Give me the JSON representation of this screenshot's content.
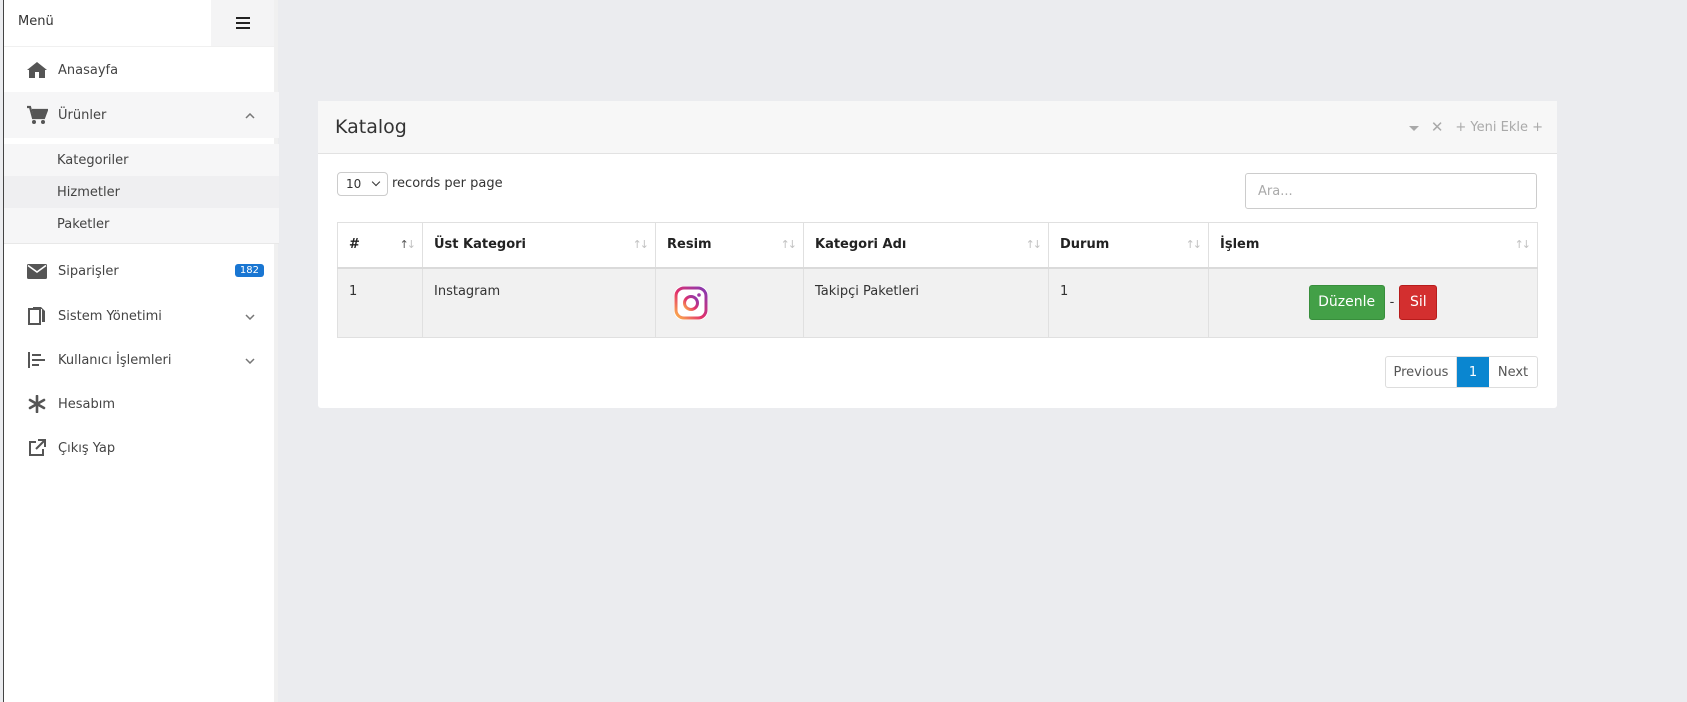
{
  "sidebar": {
    "menu_label": "Menü",
    "items": {
      "home": "Anasayfa",
      "products": "Ürünler",
      "categories": "Kategoriler",
      "services": "Hizmetler",
      "packages": "Paketler",
      "orders": "Siparişler",
      "orders_badge": "182",
      "system": "Sistem Yönetimi",
      "users": "Kullanıcı İşlemleri",
      "account": "Hesabım",
      "logout": "Çıkış Yap"
    }
  },
  "card": {
    "title": "Katalog",
    "add_new": "+ Yeni Ekle +"
  },
  "table_controls": {
    "length_value": "10",
    "length_text": "records per page",
    "search_placeholder": "Ara..."
  },
  "table": {
    "columns": [
      "#",
      "Üst Kategori",
      "Resim",
      "Kategori Adı",
      "Durum",
      "İşlem"
    ],
    "rows": [
      {
        "id": "1",
        "parent": "Instagram",
        "image_icon": "instagram-icon",
        "name": "Takipçi Paketleri",
        "status": "1"
      }
    ],
    "edit_label": "Düzenle",
    "separator": "-",
    "delete_label": "Sil"
  },
  "pagination": {
    "previous": "Previous",
    "current": "1",
    "next": "Next"
  },
  "colors": {
    "badge": "#1976d2",
    "edit_button": "#43a047",
    "delete_button": "#d32f2f",
    "active_page": "#0a86d0"
  }
}
